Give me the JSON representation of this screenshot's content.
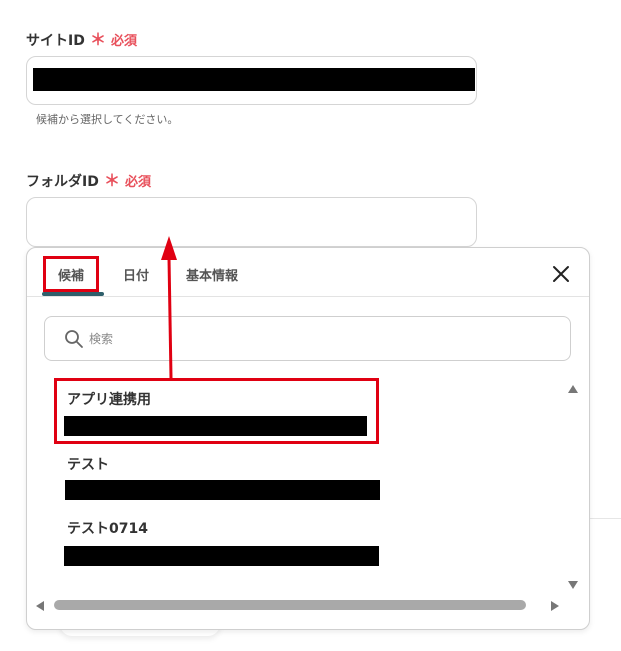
{
  "site_field": {
    "label": "サイトID",
    "required_star": "＊",
    "required_text": "必須",
    "hint": "候補から選択してください。"
  },
  "folder_field": {
    "label": "フォルダID",
    "required_star": "＊",
    "required_text": "必須",
    "value": ""
  },
  "popup": {
    "tabs": [
      {
        "label": "候補",
        "active": true
      },
      {
        "label": "日付",
        "active": false
      },
      {
        "label": "基本情報",
        "active": false
      }
    ],
    "search_placeholder": "検索",
    "options": [
      {
        "title": "アプリ連携用"
      },
      {
        "title": "テスト"
      },
      {
        "title": "テスト0714"
      }
    ]
  },
  "colors": {
    "required": "#e8505b",
    "annotation_red": "#e00012",
    "tab_underline": "#2f5f6b"
  }
}
